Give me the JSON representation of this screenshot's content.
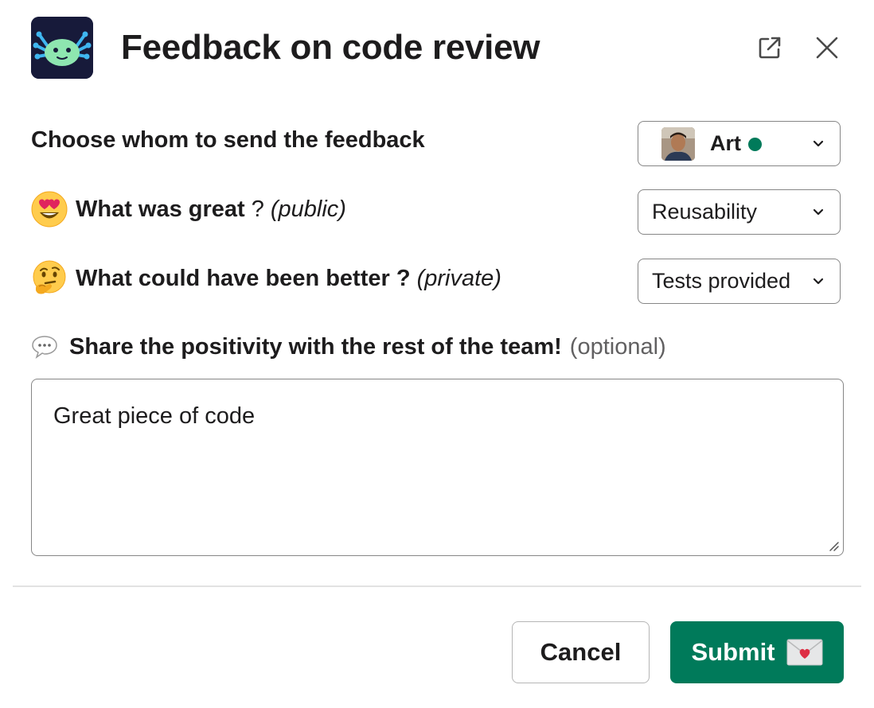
{
  "modal": {
    "title": "Feedback on code review"
  },
  "icons": {
    "app": "axolotl-app-icon",
    "popout": "external-link-icon",
    "close": "close-icon",
    "chevron": "chevron-down-icon",
    "great": "heart-eyes-emoji",
    "better": "thinking-face-emoji",
    "share": "speech-balloon-icon",
    "submit": "love-letter-emoji"
  },
  "recipient": {
    "label": "Choose whom to send the feedback",
    "selected_name": "Art",
    "presence": "active"
  },
  "great": {
    "label": "What was great",
    "question_mark": "?",
    "hint": "(public)",
    "selected": "Reusability"
  },
  "better": {
    "label": "What could have been better ?",
    "hint": "(private)",
    "selected": "Tests provided"
  },
  "share": {
    "label": "Share the positivity with the rest of the team!",
    "hint": "(optional)",
    "value": "Great piece of code"
  },
  "footer": {
    "cancel_label": "Cancel",
    "submit_label": "Submit"
  },
  "colors": {
    "primary": "#007a5a",
    "text": "#1d1c1d",
    "border": "#868686",
    "presence": "#007a5a",
    "app_icon_bg": "#171a3a"
  }
}
